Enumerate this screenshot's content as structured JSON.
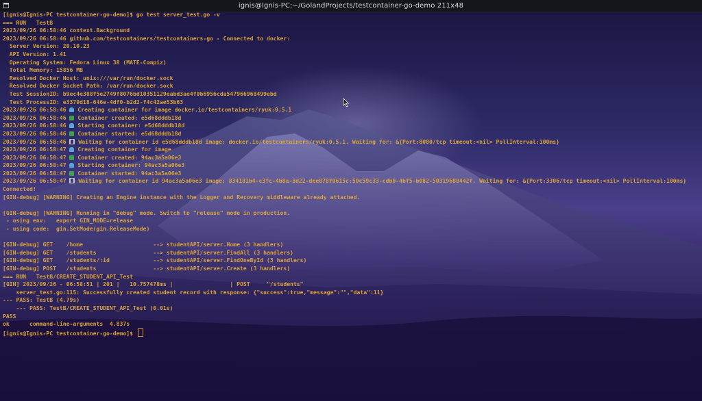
{
  "window": {
    "title": "ignis@Ignis-PC:~/GolandProjects/testcontainer-go-demo 211x48"
  },
  "terminal": {
    "lines": [
      {
        "t": "[ignis@Ignis-PC testcontainer-go-demo]$ go test server_test.go -v",
        "icon": ""
      },
      {
        "t": "=== RUN   TestB",
        "icon": ""
      },
      {
        "t": "2023/09/26 06:58:46 context.Background",
        "icon": ""
      },
      {
        "t": "2023/09/26 06:58:46 github.com/testcontainers/testcontainers-go - Connected to docker:",
        "icon": ""
      },
      {
        "t": "  Server Version: 20.10.23",
        "icon": ""
      },
      {
        "t": "  API Version: 1.41",
        "icon": ""
      },
      {
        "t": "  Operating System: Fedora Linux 38 (MATE-Compiz)",
        "icon": ""
      },
      {
        "t": "  Total Memory: 15856 MB",
        "icon": ""
      },
      {
        "t": "  Resolved Docker Host: unix:///var/run/docker.sock",
        "icon": ""
      },
      {
        "t": "  Resolved Docker Socket Path: /var/run/docker.sock",
        "icon": ""
      },
      {
        "t": "  Test SessionID: b9ec4e388f5e2749f8076bd10351129eabd3ae4f0b6956cda547966968499ebd",
        "icon": ""
      },
      {
        "t": "  Test ProcessID: e3379d18-646e-4df0-b2d2-f4c42ae53b63",
        "icon": ""
      },
      {
        "p": "2023/09/26 06:58:46 ",
        "t": " Creating container for image docker.io/testcontainers/ryuk:0.5.1",
        "icon": "whale"
      },
      {
        "p": "2023/09/26 06:58:46 ",
        "t": " Container created: e5d68dddb18d",
        "icon": "check"
      },
      {
        "p": "2023/09/26 06:58:46 ",
        "t": " Starting container: e5d68dddb18d",
        "icon": "whale"
      },
      {
        "p": "2023/09/26 06:58:46 ",
        "t": " Container started: e5d68dddb18d",
        "icon": "check"
      },
      {
        "p": "2023/09/26 06:58:46 ",
        "t": " Waiting for container id e5d68dddb18d image: docker.io/testcontainers/ryuk:0.5.1. Waiting for: &{Port:8080/tcp timeout:<nil> PollInterval:100ms}",
        "icon": "hourglass"
      },
      {
        "p": "2023/09/26 06:58:47 ",
        "t": " Creating container for image",
        "icon": "whale"
      },
      {
        "p": "2023/09/26 06:58:47 ",
        "t": " Container created: 94ac3a5a06e3",
        "icon": "check"
      },
      {
        "p": "2023/09/26 06:58:47 ",
        "t": " Starting container: 94ac3a5a06e3",
        "icon": "whale"
      },
      {
        "p": "2023/09/26 06:58:47 ",
        "t": " Container started: 94ac3a5a06e3",
        "icon": "check"
      },
      {
        "p": "2023/09/26 06:58:47 ",
        "t": " Waiting for container id 94ac3a5a06e3 image: 834181b4-c3fc-4b8a-8d22-dee878f0615c:50c59c33-cdb0-4bf5-b082-50319688442f. Waiting for: &{Port:3306/tcp timeout:<nil> PollInterval:100ms}",
        "icon": "hourglass"
      },
      {
        "t": "Connected!",
        "icon": ""
      },
      {
        "t": "[GIN-debug] [WARNING] Creating an Engine instance with the Logger and Recovery middleware already attached.",
        "icon": ""
      },
      {
        "t": "",
        "icon": ""
      },
      {
        "t": "[GIN-debug] [WARNING] Running in \"debug\" mode. Switch to \"release\" mode in production.",
        "icon": ""
      },
      {
        "t": " - using env:   export GIN_MODE=release",
        "icon": ""
      },
      {
        "t": " - using code:  gin.SetMode(gin.ReleaseMode)",
        "icon": ""
      },
      {
        "t": "",
        "icon": ""
      },
      {
        "t": "[GIN-debug] GET    /home                     --> studentAPI/server.Home (3 handlers)",
        "icon": ""
      },
      {
        "t": "[GIN-debug] GET    /students                 --> studentAPI/server.FindAll (3 handlers)",
        "icon": ""
      },
      {
        "t": "[GIN-debug] GET    /students/:id             --> studentAPI/server.FindOneById (3 handlers)",
        "icon": ""
      },
      {
        "t": "[GIN-debug] POST   /students                 --> studentAPI/server.Create (3 handlers)",
        "icon": ""
      },
      {
        "t": "=== RUN   TestB/CREATE_STUDENT_API_Test",
        "icon": ""
      },
      {
        "t": "[GIN] 2023/09/26 - 06:58:51 | 201 |   10.757478ms |                 | POST     \"/students\"",
        "icon": ""
      },
      {
        "t": "    server_test.go:115: Successfully created student record with response: {\"success\":true,\"message\":\"\",\"data\":11}",
        "icon": ""
      },
      {
        "t": "--- PASS: TestB (4.79s)",
        "icon": ""
      },
      {
        "t": "    --- PASS: TestB/CREATE_STUDENT_API_Test (0.01s)",
        "icon": ""
      },
      {
        "t": "PASS",
        "icon": ""
      },
      {
        "t": "ok      command-line-arguments  4.837s",
        "icon": ""
      }
    ],
    "prompt": "[ignis@Ignis-PC testcontainer-go-demo]$ "
  },
  "colors": {
    "text": "#d9a33a",
    "titlebar": "#15151c"
  }
}
